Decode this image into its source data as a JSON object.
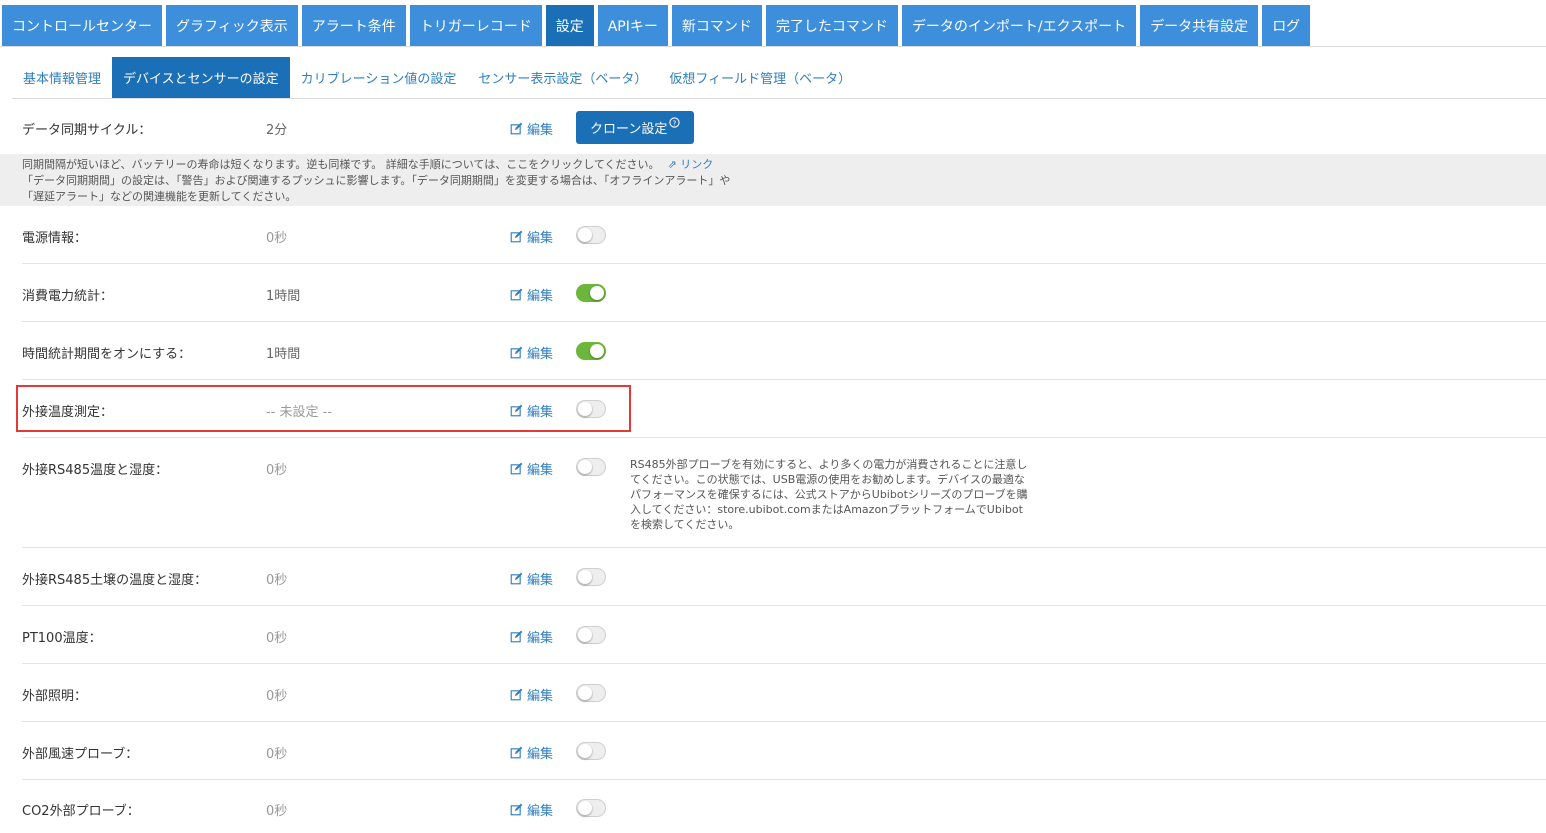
{
  "top_tabs": [
    {
      "label": "コントロールセンター",
      "active": false
    },
    {
      "label": "グラフィック表示",
      "active": false
    },
    {
      "label": "アラート条件",
      "active": false
    },
    {
      "label": "トリガーレコード",
      "active": false
    },
    {
      "label": "設定",
      "active": true
    },
    {
      "label": "APIキー",
      "active": false
    },
    {
      "label": "新コマンド",
      "active": false
    },
    {
      "label": "完了したコマンド",
      "active": false
    },
    {
      "label": "データのインポート/エクスポート",
      "active": false
    },
    {
      "label": "データ共有設定",
      "active": false
    },
    {
      "label": "ログ",
      "active": false
    }
  ],
  "sub_tabs": [
    {
      "label": "基本情報管理",
      "active": false
    },
    {
      "label": "デバイスとセンサーの設定",
      "active": true
    },
    {
      "label": "カリブレーション値の設定",
      "active": false
    },
    {
      "label": "センサー表示設定（ベータ）",
      "active": false
    },
    {
      "label": "仮想フィールド管理（ベータ）",
      "active": false
    }
  ],
  "sync": {
    "label": "データ同期サイクル：",
    "value": "2分",
    "edit_label": "編集",
    "clone_label": "クローン設定",
    "clone_help_glyph": "?"
  },
  "info": {
    "line1": "同期間隔が短いほど、バッテリーの寿命は短くなります。逆も同様です。 詳細な手順については、ここをクリックしてください。",
    "link_label": "リンク",
    "line2": "「データ同期期間」の設定は、「警告」および関連するプッシュに影響します。「データ同期期間」を変更する場合は、「オフラインアラート」や",
    "line3": "「遅延アラート」などの関連機能を更新してください。"
  },
  "edit_label": "編集",
  "settings": [
    {
      "label": "電源情報：",
      "value": "0秒",
      "enabled": false
    },
    {
      "label": "消費電力統計：",
      "value": "1時間",
      "enabled": true
    },
    {
      "label": "時間統計期間をオンにする：",
      "value": "1時間",
      "enabled": true
    },
    {
      "label": "外接温度測定：",
      "value": "-- 未設定 --",
      "enabled": false
    },
    {
      "label": "外接RS485温度と湿度：",
      "value": "0秒",
      "enabled": false
    },
    {
      "label": "外接RS485土壌の温度と湿度：",
      "value": "0秒",
      "enabled": false
    },
    {
      "label": "PT100温度：",
      "value": "0秒",
      "enabled": false
    },
    {
      "label": "外部照明：",
      "value": "0秒",
      "enabled": false
    },
    {
      "label": "外部風速プローブ：",
      "value": "0秒",
      "enabled": false
    },
    {
      "label": "CO2外部プローブ：",
      "value": "0秒",
      "enabled": false
    }
  ],
  "rs485_note": "RS485外部プローブを有効にすると、より多くの電力が消費されることに注意してください。この状態では、USB電源の使用をお勧めします。デバイスの最適なパフォーマンスを確保するには、公式ストアからUbibotシリーズのプローブを購入してください：store.ubibot.comまたはAmazonプラットフォームでUbibotを検索してください。",
  "colors": {
    "tab_blue": "#3d8fdc",
    "tab_active": "#1a6fb6",
    "link_blue": "#2f7fc0",
    "toggle_on": "#6bb63b",
    "highlight_red": "#e53935"
  }
}
